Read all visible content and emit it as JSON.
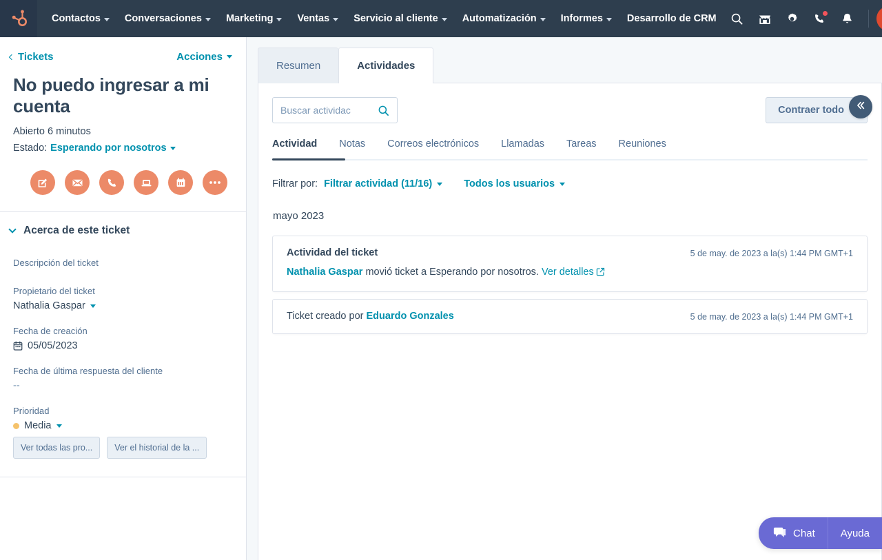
{
  "topnav": {
    "logo_icon": "hubspot-sprocket-logo",
    "items": [
      {
        "label": "Contactos",
        "has_caret": true
      },
      {
        "label": "Conversaciones",
        "has_caret": true
      },
      {
        "label": "Marketing",
        "has_caret": true
      },
      {
        "label": "Ventas",
        "has_caret": true
      },
      {
        "label": "Servicio al cliente",
        "has_caret": true
      },
      {
        "label": "Automatización",
        "has_caret": true
      },
      {
        "label": "Informes",
        "has_caret": true
      },
      {
        "label": "Desarrollo de CRM",
        "has_caret": false
      }
    ],
    "icons": [
      {
        "name": "search-icon"
      },
      {
        "name": "marketplace-icon"
      },
      {
        "name": "settings-gear-icon"
      },
      {
        "name": "calling-icon",
        "badge": true
      },
      {
        "name": "notifications-bell-icon"
      }
    ],
    "avatar_name": "user-avatar",
    "colors": {
      "bar": "#2e3e4e",
      "logo_bg": "#28374a",
      "logo": "#ec8a68",
      "badge": "#f2545b"
    }
  },
  "sidebar": {
    "back_label": "Tickets",
    "actions_label": "Acciones",
    "ticket_title": "No puedo ingresar a mi cuenta",
    "open_since": "Abierto 6 minutos",
    "state_label": "Estado:",
    "state_value": "Esperando por nosotros",
    "action_buttons": [
      {
        "name": "create-note-button",
        "icon": "note-edit-icon"
      },
      {
        "name": "send-email-button",
        "icon": "email-icon"
      },
      {
        "name": "log-call-button",
        "icon": "phone-icon"
      },
      {
        "name": "schedule-meeting-button",
        "icon": "laptop-icon"
      },
      {
        "name": "create-task-button",
        "icon": "calendar-task-icon"
      },
      {
        "name": "more-actions-button",
        "icon": "ellipsis-icon"
      }
    ],
    "about_title": "Acerca de este ticket",
    "properties": [
      {
        "label": "Descripción del ticket",
        "value": "",
        "type": "empty"
      },
      {
        "label": "Propietario del ticket",
        "value": "Nathalia Gaspar",
        "type": "dropdown"
      },
      {
        "label": "Fecha de creación",
        "value": "05/05/2023",
        "type": "date"
      },
      {
        "label": "Fecha de última respuesta del cliente",
        "value": "--",
        "type": "muted"
      },
      {
        "label": "Prioridad",
        "value": "Media",
        "type": "priority"
      }
    ],
    "buttons": [
      {
        "label": "Ver todas las pro...",
        "name": "view-all-properties-button"
      },
      {
        "label": "Ver el historial de la ...",
        "name": "view-property-history-button"
      }
    ],
    "colors": {
      "accent": "#0091ae",
      "text": "#33475b",
      "action_btn": "#ec8a68",
      "priority_dot": "#f5c26b"
    }
  },
  "main": {
    "tabs": [
      {
        "label": "Resumen",
        "active": false,
        "name": "tab-resumen"
      },
      {
        "label": "Actividades",
        "active": true,
        "name": "tab-actividades"
      }
    ],
    "search": {
      "placeholder": "Buscar actividac",
      "value": "",
      "icon": "search-icon"
    },
    "collapse_all_label": "Contraer todo",
    "subtabs": [
      {
        "label": "Actividad",
        "active": true
      },
      {
        "label": "Notas",
        "active": false
      },
      {
        "label": "Correos electrónicos",
        "active": false
      },
      {
        "label": "Llamadas",
        "active": false
      },
      {
        "label": "Tareas",
        "active": false
      },
      {
        "label": "Reuniones",
        "active": false
      }
    ],
    "filter": {
      "prefix": "Filtrar por:",
      "activity_filter": "Filtrar actividad (11/16)",
      "user_filter": "Todos los usuarios"
    },
    "month_group": "mayo 2023",
    "activities": [
      {
        "type": "detailed",
        "title": "Actividad del ticket",
        "timestamp": "5 de may. de 2023 a la(s) 1:44 PM GMT+1",
        "actor": "Nathalia Gaspar",
        "text": " movió ticket a Esperando por nosotros. ",
        "link": "Ver detalles",
        "link_icon": "external-link-icon"
      },
      {
        "type": "simple",
        "prefix": "Ticket creado por ",
        "actor": "Eduardo Gonzales",
        "timestamp": "5 de may. de 2023 a la(s) 1:44 PM GMT+1"
      }
    ],
    "collapse_panel_icon": "double-chevron-left-icon"
  },
  "chat_widget": {
    "chat_label": "Chat",
    "help_label": "Ayuda",
    "chat_icon": "chat-bubble-icon",
    "color": "#6a6ad4"
  }
}
